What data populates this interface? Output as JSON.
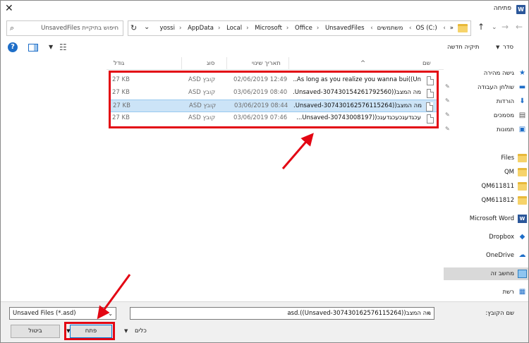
{
  "window": {
    "title": "פתיחה",
    "app_icon": "W"
  },
  "search": {
    "placeholder": "חיפוש בתיקיית UnsavedFiles"
  },
  "address": {
    "segments": [
      "OS (C:)",
      "משתמשים",
      "yossi",
      "AppData",
      "Local",
      "Microsoft",
      "Office",
      "UnsavedFiles"
    ],
    "overflow": "«",
    "separator": "›"
  },
  "toolbar": {
    "organize": "סדר",
    "new_folder": "תיקיה חדשה"
  },
  "columns": {
    "name": "שם",
    "date": "תאריך שינוי",
    "type": "סוג",
    "size": "גודל"
  },
  "files": [
    {
      "name": "As long as you realize you wanna bui((Un...",
      "date": "02/06/2019 12:49",
      "type": "קובץ ASD",
      "size": "27 KB",
      "selected": false
    },
    {
      "name": "מה המצב((Unsaved-307430154261792560...",
      "date": "03/06/2019 08:40",
      "type": "קובץ ASD",
      "size": "27 KB",
      "selected": false
    },
    {
      "name": "מה המצב((Unsaved-307430162576115264...",
      "date": "03/06/2019 08:44",
      "type": "קובץ ASD",
      "size": "27 KB",
      "selected": true
    },
    {
      "name": "עכגדעגכעכגדעגכ((Unsaved-30743008197...",
      "date": "03/06/2019 07:46",
      "type": "קובץ ASD",
      "size": "27 KB",
      "selected": false
    }
  ],
  "nav": [
    {
      "label": "גישה מהירה",
      "icon": "star-icon",
      "glyph": "★"
    },
    {
      "label": "שולחן העבודה",
      "icon": "desktop-icon",
      "glyph": "▬",
      "pinned": true
    },
    {
      "label": "הורדות",
      "icon": "download-icon",
      "glyph": "⬇",
      "pinned": true
    },
    {
      "label": "מסמכים",
      "icon": "documents-icon",
      "glyph": "▤",
      "pinned": true
    },
    {
      "label": "תמונות",
      "icon": "pictures-icon",
      "glyph": "▣",
      "pinned": true
    },
    {
      "label": "Files",
      "icon": "folder-icon"
    },
    {
      "label": "QM",
      "icon": "folder-icon"
    },
    {
      "label": "QM611811",
      "icon": "folder-icon"
    },
    {
      "label": "QM611812",
      "icon": "folder-icon"
    },
    {
      "label": "Microsoft Word",
      "icon": "word-icon",
      "glyph": "W"
    },
    {
      "label": "Dropbox",
      "icon": "dropbox-icon",
      "glyph": "◆"
    },
    {
      "label": "OneDrive",
      "icon": "onedrive-icon",
      "glyph": "☁"
    },
    {
      "label": "מחשב זה",
      "icon": "computer-icon",
      "selected": true
    },
    {
      "label": "רשת",
      "icon": "network-icon",
      "glyph": "▦"
    }
  ],
  "footer": {
    "filename_label": "שם הקובץ:",
    "filename_value": "מה המצב((Unsaved-307430162576115264)).asd",
    "filetype": "Unsaved Files (*.asd)",
    "tools": "כלים",
    "open": "פתח",
    "cancel": "ביטול"
  },
  "colors": {
    "accent": "#0078d7",
    "annotation": "#e30613",
    "selection": "#cce4f7"
  }
}
